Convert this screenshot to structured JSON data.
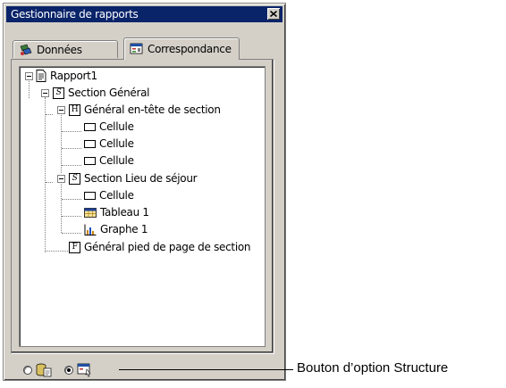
{
  "window": {
    "title": "Gestionnaire de rapports",
    "close_glyph": "×"
  },
  "tabs": [
    {
      "label": "Données",
      "icon": "data-source-icon",
      "active": false
    },
    {
      "label": "Correspondance",
      "icon": "mapping-icon",
      "active": true
    }
  ],
  "tree": {
    "items": [
      {
        "label": "Rapport1",
        "icon": "report-icon",
        "level": 0,
        "expanded": true
      },
      {
        "label": "Section Général",
        "icon": "section-icon",
        "glyph": "S",
        "level": 1,
        "expanded": true
      },
      {
        "label": "Général en-tête de section",
        "icon": "header-icon",
        "glyph": "H",
        "level": 2,
        "expanded": true
      },
      {
        "label": "Cellule",
        "icon": "cell-icon",
        "level": 3
      },
      {
        "label": "Cellule",
        "icon": "cell-icon",
        "level": 3
      },
      {
        "label": "Cellule",
        "icon": "cell-icon",
        "level": 3
      },
      {
        "label": "Section Lieu de séjour",
        "icon": "section-icon",
        "glyph": "S",
        "level": 2,
        "expanded": true
      },
      {
        "label": "Cellule",
        "icon": "cell-icon",
        "level": 3
      },
      {
        "label": "Tableau 1",
        "icon": "table-icon",
        "level": 3
      },
      {
        "label": "Graphe 1",
        "icon": "chart-icon",
        "level": 3
      },
      {
        "label": "Général pied de page de section",
        "icon": "footer-icon",
        "glyph": "F",
        "level": 2
      }
    ]
  },
  "view_options": [
    {
      "icon": "data-view-icon",
      "selected": false
    },
    {
      "icon": "structure-view-icon",
      "selected": true
    }
  ],
  "callout": {
    "text": "Bouton d’option Structure"
  },
  "colors": {
    "titlebar": "#0a246a",
    "face": "#d4d0c8"
  }
}
